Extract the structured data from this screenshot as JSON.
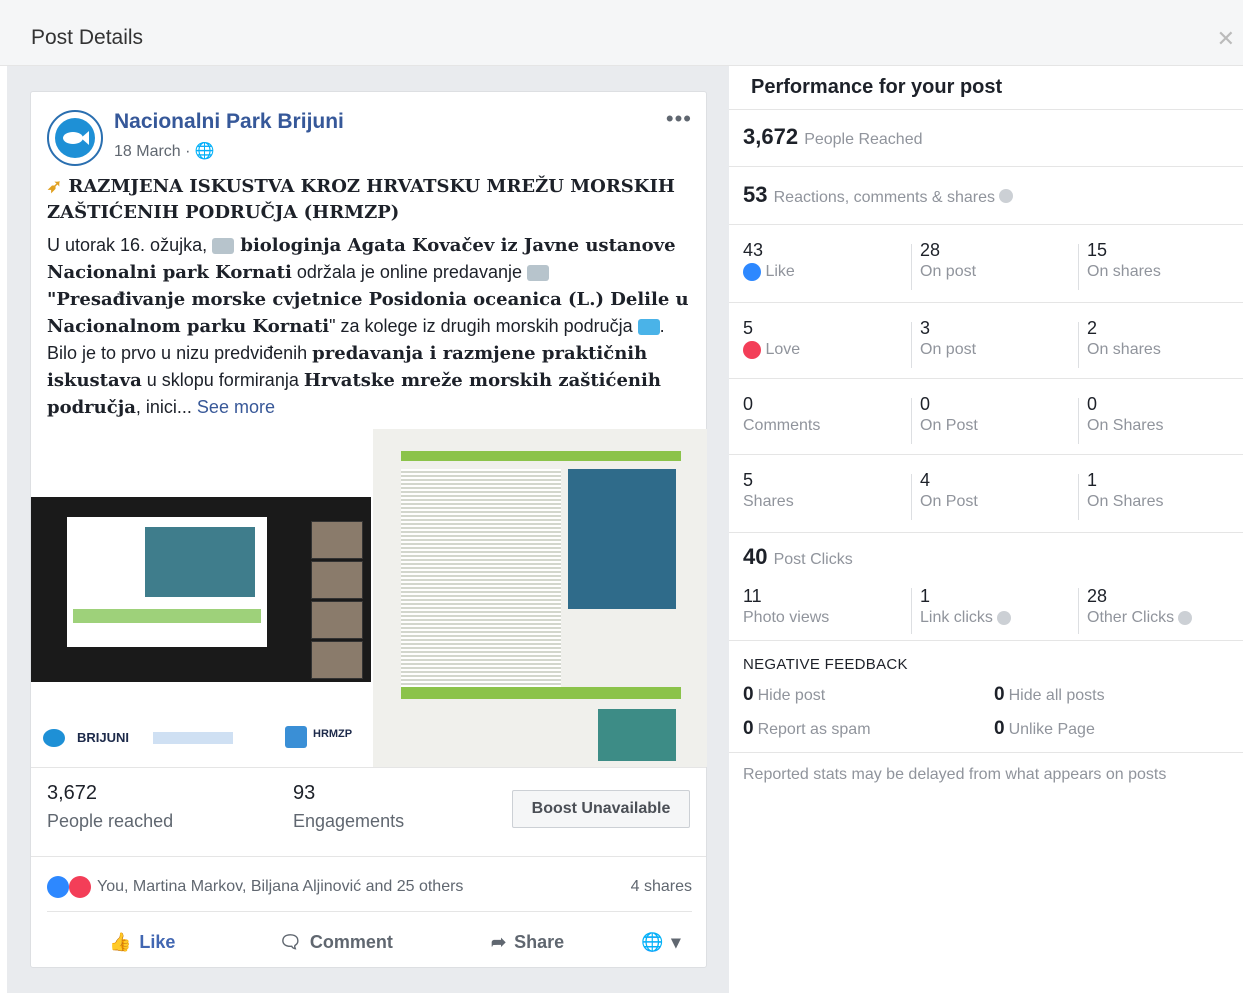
{
  "header": {
    "title": "Post Details",
    "close_icon": "close-icon"
  },
  "post": {
    "page_name": "Nacionalni Park Brijuni",
    "date": "18 March · ",
    "headline": "RAZMJENA ISKUSTVA KROZ HRVATSKU MREŽU MORSKIH ZAŠTIĆENIH PODRUČJA (HRMZP)",
    "body_1": "U utorak 16. ožujka,",
    "body_2": " biologinja Agata Kovačev iz Javne ustanove Nacionalni park Kornati",
    "body_3": " održala je online predavanje ",
    "body_4": "\"Presađivanje morske cvjetnice Posidonia oceanica (L.) Delile u Nacionalnom parku Kornati",
    "body_5": "\" za kolege iz drugih morskih područja ",
    "body_6": ". Bilo je to prvo u nizu predviđenih ",
    "body_7": "predavanja i razmjene praktičnih iskustava",
    "body_8": " u sklopu formiranja ",
    "body_9": "Hrvatske mreže morskih zaštićenih područja",
    "body_10": ", inici...",
    "see_more": "See more",
    "logo_brijuni": "BRIJUNI",
    "logo_hrmzp": "HRMZP"
  },
  "post_stats": {
    "reached_value": "3,672",
    "reached_label": "People reached",
    "engagements_value": "93",
    "engagements_label": "Engagements",
    "boost_label": "Boost Unavailable"
  },
  "reactions": {
    "names": "You, Martina Markov, Biljana Aljinović and 25 others",
    "shares": "4 shares"
  },
  "actions": {
    "like": "Like",
    "comment": "Comment",
    "share": "Share"
  },
  "performance": {
    "title": "Performance for your post",
    "people_reached_value": "3,672",
    "people_reached_label": "People Reached",
    "reactions_value": "53",
    "reactions_label": "Reactions, comments & shares",
    "grid": [
      {
        "a_v": "43",
        "a_l": "Like",
        "b_v": "28",
        "b_l": "On post",
        "c_v": "15",
        "c_l": "On shares"
      },
      {
        "a_v": "5",
        "a_l": "Love",
        "b_v": "3",
        "b_l": "On post",
        "c_v": "2",
        "c_l": "On shares"
      },
      {
        "a_v": "0",
        "a_l": "Comments",
        "b_v": "0",
        "b_l": "On Post",
        "c_v": "0",
        "c_l": "On Shares"
      },
      {
        "a_v": "5",
        "a_l": "Shares",
        "b_v": "4",
        "b_l": "On Post",
        "c_v": "1",
        "c_l": "On Shares"
      }
    ],
    "post_clicks_value": "40",
    "post_clicks_label": "Post Clicks",
    "clicks": {
      "photo_v": "11",
      "photo_l": "Photo views",
      "link_v": "1",
      "link_l": "Link clicks",
      "other_v": "28",
      "other_l": "Other Clicks"
    },
    "negative_title": "NEGATIVE FEEDBACK",
    "negative": {
      "hide_post_v": "0",
      "hide_post_l": "Hide post",
      "hide_all_v": "0",
      "hide_all_l": "Hide all posts",
      "spam_v": "0",
      "spam_l": "Report as spam",
      "unlike_v": "0",
      "unlike_l": "Unlike Page"
    },
    "note": "Reported stats may be delayed from what appears on posts"
  },
  "colors": {
    "fb_blue": "#365899",
    "like_blue": "#2d88ff",
    "love_red": "#f33e58",
    "accent_green": "#8bc34a"
  }
}
